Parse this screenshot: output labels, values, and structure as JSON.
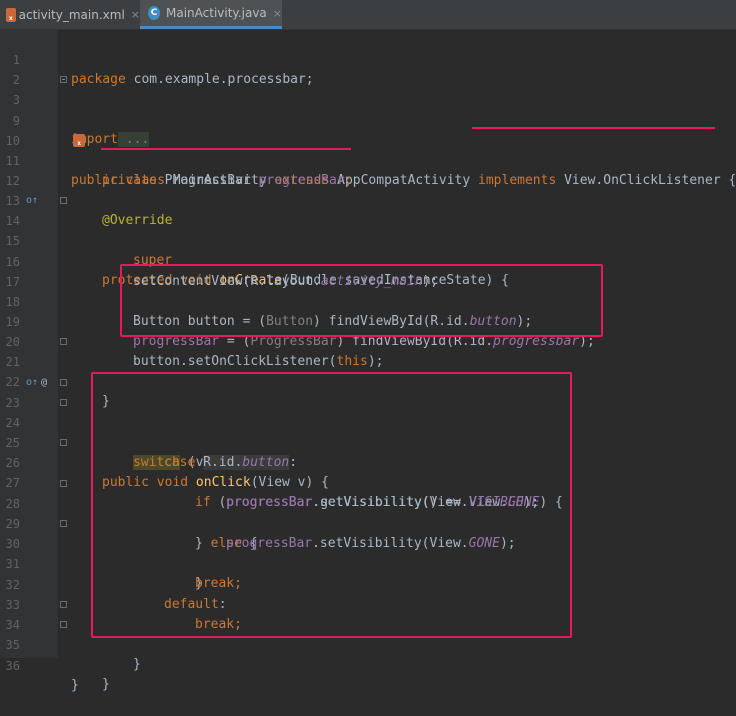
{
  "tabs": [
    {
      "label": "activity_main.xml",
      "icon": "xml-file-icon",
      "active": false
    },
    {
      "label": "MainActivity.java",
      "icon": "java-class-icon",
      "active": true
    }
  ],
  "close_glyph": "×",
  "line_numbers": [
    "1",
    "2",
    "3",
    "9",
    "10",
    "11",
    "12",
    "13",
    "14",
    "15",
    "16",
    "17",
    "18",
    "19",
    "20",
    "21",
    "22",
    "23",
    "24",
    "25",
    "26",
    "27",
    "28",
    "29",
    "30",
    "31",
    "32",
    "33",
    "34",
    "35",
    "36"
  ],
  "code": {
    "l1": {
      "kw": "package",
      "rest": " com.example.processbar;"
    },
    "l3": {
      "kw": "import",
      "rest": " ..."
    },
    "l10": {
      "a": "public class ",
      "b": "MainActivity ",
      "c": "extends ",
      "d": "AppCompatActivity ",
      "e": "implements ",
      "f": "View.OnClickListener",
      "g": " {"
    },
    "l11": {
      "a": "private ",
      "b": "ProgressBar ",
      "c": "progressBar",
      ";": ";"
    },
    "l13": "@Override",
    "l14": {
      "a": "protected void ",
      "b": "onCreate",
      "c": "(Bundle savedInstanceState) {"
    },
    "l15": {
      "a": "super",
      ".": ".onCreate(savedInstanceState);"
    },
    "l16": {
      "a": "setContentView(R.layout.",
      "b": "activity_main",
      "c": ");"
    },
    "l18": {
      "a": "Button button = (",
      "b": "Button",
      ")": ") findViewById(R.id.",
      "c": "button",
      "d": ");"
    },
    "l19": {
      "a": "progressBar",
      "b": " = (",
      "c": "ProgressBar",
      "d": ") findViewById(R.id.",
      "e": "progressbar",
      "f": ");"
    },
    "l20": {
      "a": "button.setOnClickListener(",
      "b": "this",
      "c": ");"
    },
    "l21": "}",
    "l23": {
      "a": "public void ",
      "b": "onClick",
      "c": "(View v) {"
    },
    "l24": {
      "a": "switch",
      "b": " (v.getId()) {"
    },
    "l25": {
      "a": "case ",
      "b": "R.id.",
      "c": "button",
      ":": ":"
    },
    "l26": {
      "a": "if ",
      "b": "(",
      "c": "progressBar",
      "d": ".getVisibility() == View.",
      "e": "GONE",
      "f": ") {"
    },
    "l27": {
      "a": "progressBar",
      "b": ".setVisibility(View.",
      "c": "VISIBLE",
      "d": ");"
    },
    "l28": {
      "a": "} ",
      "b": "else",
      "c": " {"
    },
    "l29": {
      "a": "progressBar",
      "b": ".setVisibility(View.",
      "c": "GONE",
      "d": ");"
    },
    "l30": "}",
    "l31": {
      "a": "break",
      ";": ";"
    },
    "l32": {
      "a": "default",
      ":": ":"
    },
    "l33": {
      "a": "break",
      ";": ";"
    },
    "l34": "}",
    "l35": "}",
    "l36": "}"
  },
  "gutter_icons": {
    "override": "o↑",
    "implements": "o↑",
    "at": "@"
  },
  "colors": {
    "accent": "#e8195a",
    "background": "#2b2b2b",
    "keyword": "#cc7832",
    "method": "#ffc66d",
    "field": "#9876aa"
  }
}
